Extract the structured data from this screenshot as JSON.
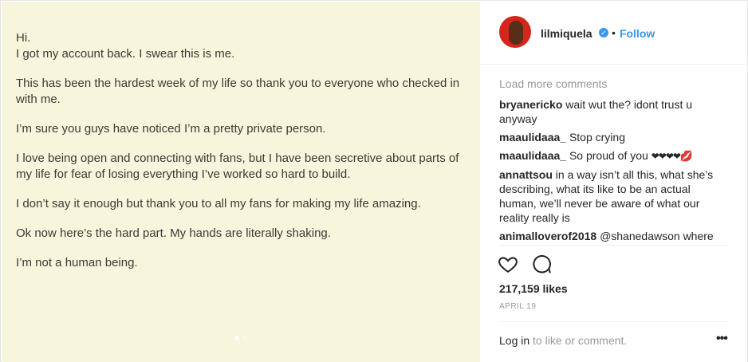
{
  "post_image": {
    "lines": [
      "Hi.\nI got my account back. I swear this is me.",
      "This has been the hardest week of my life so thank you to everyone who checked in with me.",
      "I’m sure you guys have noticed I’m a pretty private person.",
      "I love being open and connecting with fans, but I have been secretive about parts of my life for fear of losing everything I’ve worked so hard to build.",
      "I don’t say it enough but thank you to all my fans for making my life amazing.",
      "Ok now here’s the hard part. My hands are literally shaking.",
      "I’m not a human being."
    ],
    "background_color": "#f7f6dc"
  },
  "header": {
    "username": "lilmiquela",
    "verified_icon": "verified-badge-icon",
    "bullet": "•",
    "follow_label": "Follow"
  },
  "comments": {
    "load_more": "Load more comments",
    "items": [
      {
        "user": "bryanericko",
        "text": "wait wut the? idont trust u anyway"
      },
      {
        "user": "maaulidaaa_",
        "text": "Stop crying"
      },
      {
        "user": "maaulidaaa_",
        "text": "So proud of you",
        "hearts": "❤❤❤❤",
        "kiss": "💋"
      },
      {
        "user": "annattsou",
        "text": "in a way isn’t all this, what she’s describing, what its like to be an actual human, we’ll never be aware of what our reality really is"
      },
      {
        "user": "animalloverof2018",
        "text": "@shanedawson where"
      }
    ]
  },
  "actions": {
    "like_icon": "heart-icon",
    "comment_icon": "comment-icon"
  },
  "likes": "217,159 likes",
  "date": "APRIL 19",
  "footer": {
    "login_link": "Log in",
    "login_rest": " to like or comment.",
    "more_icon": "more-options-icon",
    "more_glyph": "•••"
  },
  "colors": {
    "accent": "#3897f0",
    "muted": "#999999",
    "text": "#262626"
  }
}
